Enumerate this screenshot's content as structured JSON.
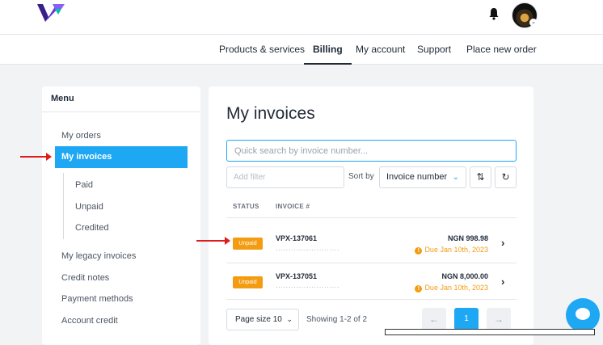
{
  "colors": {
    "accent": "#1ea7f3",
    "unpaid": "#f39c12",
    "arrow": "#e01b1b"
  },
  "nav": {
    "products": "Products & services",
    "billing": "Billing",
    "account": "My account",
    "support": "Support",
    "order": "Place new order"
  },
  "menu": {
    "title": "Menu",
    "orders": "My orders",
    "invoices": "My invoices",
    "paid": "Paid",
    "unpaid": "Unpaid",
    "credited": "Credited",
    "legacy": "My legacy invoices",
    "credit_notes": "Credit notes",
    "payment_methods": "Payment methods",
    "account_credit": "Account credit"
  },
  "main": {
    "title": "My invoices",
    "search_placeholder": "Quick search by invoice number...",
    "filter_placeholder": "Add filter",
    "sort_label": "Sort by",
    "sort_value": "Invoice number",
    "columns": {
      "status": "STATUS",
      "invoice": "INVOICE #"
    },
    "rows": [
      {
        "status": "Unpaid",
        "number": "VPX-137061",
        "desc": "·························",
        "amount": "NGN 998.98",
        "due": "Due Jan 10th, 2023"
      },
      {
        "status": "Unpaid",
        "number": "VPX-137051",
        "desc": "·························",
        "amount": "NGN 8,000.00",
        "due": "Due Jan 10th, 2023"
      }
    ],
    "page_size": "Page size 10",
    "showing": "Showing 1-2 of 2",
    "prev": "←",
    "current_page": "1",
    "next": "→"
  },
  "icons": {
    "logo": "logo-icon",
    "bell": "bell-icon",
    "sort_order": "sort-order-icon",
    "refresh": "refresh-icon",
    "chat": "chat-icon",
    "chevron": "›",
    "chevron_down": "⌄",
    "info": "!",
    "refresh_glyph": "↻",
    "sort_glyph": "⇅"
  }
}
